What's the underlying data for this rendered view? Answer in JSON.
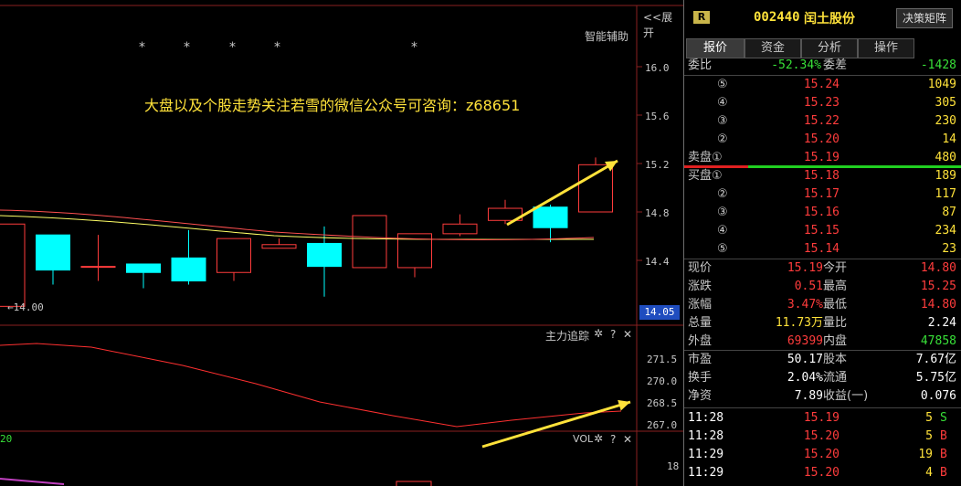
{
  "chart": {
    "smart_assist": "智能辅助",
    "expand": "<<展开",
    "notice": "大盘以及个股走势关注若雪的微信公众号可咨询：z68651",
    "stars": [
      "*",
      "*",
      "*",
      "*",
      "*"
    ],
    "low_marker": "←14.00",
    "price_ticks": [
      "16.0",
      "15.6",
      "15.2",
      "14.8",
      "14.4"
    ],
    "current_price_tag": "14.05",
    "sub1_title": "主力追踪",
    "sub1_ticks": [
      "271.5",
      "270.0",
      "268.5",
      "267.0"
    ],
    "sub2_title": "VOL",
    "sub2_ticks": [
      "18"
    ],
    "left_label": "20",
    "ctl_gear": "✲",
    "ctl_help": "?",
    "ctl_close": "✕"
  },
  "candles": [
    {
      "o": 14.02,
      "c": 14.7,
      "h": 14.7,
      "l": 14.02
    },
    {
      "o": 14.61,
      "c": 14.32,
      "h": 14.61,
      "l": 14.2
    },
    {
      "o": 14.35,
      "c": 14.35,
      "h": 14.61,
      "l": 14.23
    },
    {
      "o": 14.37,
      "c": 14.3,
      "h": 14.37,
      "l": 14.17
    },
    {
      "o": 14.42,
      "c": 14.23,
      "h": 14.65,
      "l": 14.2
    },
    {
      "o": 14.3,
      "c": 14.58,
      "h": 14.58,
      "l": 14.23
    },
    {
      "o": 14.5,
      "c": 14.53,
      "h": 14.58,
      "l": 14.5
    },
    {
      "o": 14.54,
      "c": 14.35,
      "h": 14.68,
      "l": 14.1
    },
    {
      "o": 14.34,
      "c": 14.77,
      "h": 14.77,
      "l": 14.34
    },
    {
      "o": 14.34,
      "c": 14.62,
      "h": 14.62,
      "l": 14.26
    },
    {
      "o": 14.62,
      "c": 14.7,
      "h": 14.78,
      "l": 14.6
    },
    {
      "o": 14.73,
      "c": 14.83,
      "h": 14.9,
      "l": 14.7
    },
    {
      "o": 14.84,
      "c": 14.67,
      "h": 14.86,
      "l": 14.55
    },
    {
      "o": 14.8,
      "c": 15.19,
      "h": 15.25,
      "l": 14.8
    }
  ],
  "header": {
    "badge": "R",
    "code": "002440",
    "name": "闰土股份",
    "matrix_button": "决策矩阵"
  },
  "tabs": [
    "报价",
    "资金",
    "分析",
    "操作"
  ],
  "weibi": {
    "label1": "委比",
    "value1": "-52.34%",
    "label2": "委差",
    "value2": "-1428"
  },
  "asks": [
    {
      "label": "⑤",
      "price": "15.24",
      "vol": "1049"
    },
    {
      "label": "④",
      "price": "15.23",
      "vol": "305"
    },
    {
      "label": "③",
      "price": "15.22",
      "vol": "230"
    },
    {
      "label": "②",
      "price": "15.20",
      "vol": "14"
    },
    {
      "label": "卖盘①",
      "price": "15.19",
      "vol": "480"
    }
  ],
  "bids": [
    {
      "label": "买盘①",
      "price": "15.18",
      "vol": "189"
    },
    {
      "label": "②",
      "price": "15.17",
      "vol": "117"
    },
    {
      "label": "③",
      "price": "15.16",
      "vol": "87"
    },
    {
      "label": "④",
      "price": "15.15",
      "vol": "234"
    },
    {
      "label": "⑤",
      "price": "15.14",
      "vol": "23"
    }
  ],
  "stats": [
    {
      "l1": "现价",
      "v1": "15.19",
      "c1": "red",
      "l2": "今开",
      "v2": "14.80",
      "c2": "red"
    },
    {
      "l1": "涨跌",
      "v1": "0.51",
      "c1": "red",
      "l2": "最高",
      "v2": "15.25",
      "c2": "red"
    },
    {
      "l1": "涨幅",
      "v1": "3.47%",
      "c1": "red",
      "l2": "最低",
      "v2": "14.80",
      "c2": "red"
    },
    {
      "l1": "总量",
      "v1": "11.73万",
      "c1": "yellow",
      "l2": "量比",
      "v2": "2.24",
      "c2": "white"
    },
    {
      "l1": "外盘",
      "v1": "69399",
      "c1": "red",
      "l2": "内盘",
      "v2": "47858",
      "c2": "green"
    },
    {
      "l1": "市盈",
      "v1": "50.17",
      "c1": "white",
      "l2": "股本",
      "v2": "7.67亿",
      "c2": "white"
    },
    {
      "l1": "换手",
      "v1": "2.04%",
      "c1": "white",
      "l2": "流通",
      "v2": "5.75亿",
      "c2": "white"
    },
    {
      "l1": "净资",
      "v1": "7.89",
      "c1": "white",
      "l2": "收益(一)",
      "v2": "0.076",
      "c2": "white"
    }
  ],
  "ticks": [
    {
      "time": "11:28",
      "price": "15.19",
      "vol": "5",
      "side": "S",
      "sc": "green"
    },
    {
      "time": "11:28",
      "price": "15.20",
      "vol": "5",
      "side": "B",
      "sc": "red"
    },
    {
      "time": "11:29",
      "price": "15.20",
      "vol": "19",
      "side": "B",
      "sc": "red"
    },
    {
      "time": "11:29",
      "price": "15.20",
      "vol": "4",
      "side": "B",
      "sc": "red"
    }
  ],
  "colors": {
    "up": "#ff3c3c",
    "down": "#00ffff",
    "ma1": "#ffff66",
    "ma2": "#ff5050",
    "accent": "#ffe23a"
  }
}
